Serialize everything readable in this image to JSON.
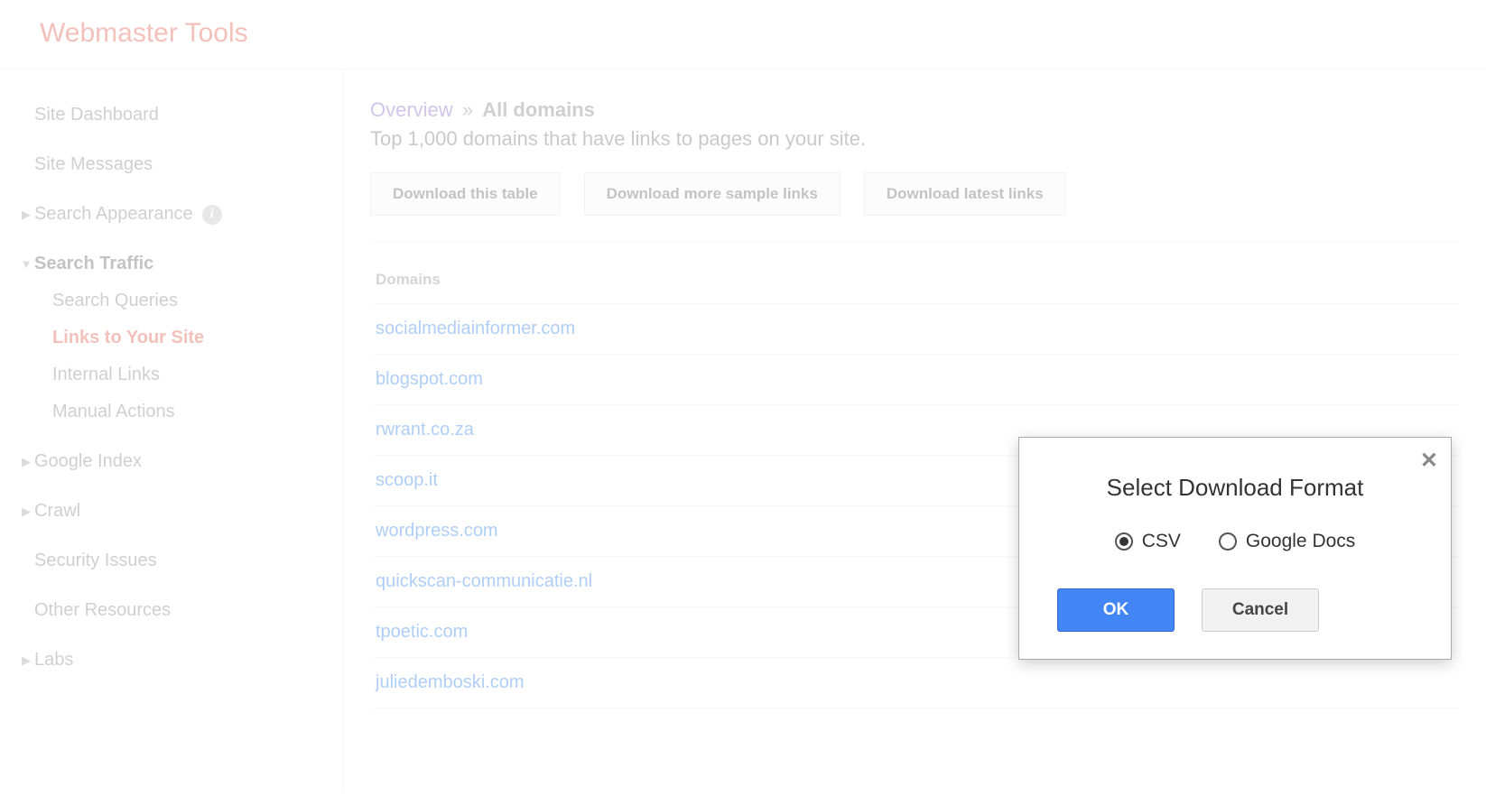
{
  "header": {
    "title": "Webmaster Tools"
  },
  "sidebar": {
    "site_dashboard": "Site Dashboard",
    "site_messages": "Site Messages",
    "search_appearance": "Search Appearance",
    "search_traffic": "Search Traffic",
    "search_traffic_children": {
      "search_queries": "Search Queries",
      "links_to_your_site": "Links to Your Site",
      "internal_links": "Internal Links",
      "manual_actions": "Manual Actions"
    },
    "google_index": "Google Index",
    "crawl": "Crawl",
    "security_issues": "Security Issues",
    "other_resources": "Other Resources",
    "labs": "Labs"
  },
  "breadcrumb": {
    "overview": "Overview",
    "separator": "»",
    "current": "All domains"
  },
  "subtext": "Top 1,000 domains that have links to pages on your site.",
  "buttons": {
    "download_table": "Download this table",
    "download_more": "Download more sample links",
    "download_latest": "Download latest links"
  },
  "table": {
    "header": "Domains",
    "rows": [
      "socialmediainformer.com",
      "blogspot.com",
      "rwrant.co.za",
      "scoop.it",
      "wordpress.com",
      "quickscan-communicatie.nl",
      "tpoetic.com",
      "juliedemboski.com"
    ]
  },
  "dialog": {
    "title": "Select Download Format",
    "option_csv": "CSV",
    "option_gdocs": "Google Docs",
    "ok": "OK",
    "cancel": "Cancel",
    "selected": "csv"
  }
}
